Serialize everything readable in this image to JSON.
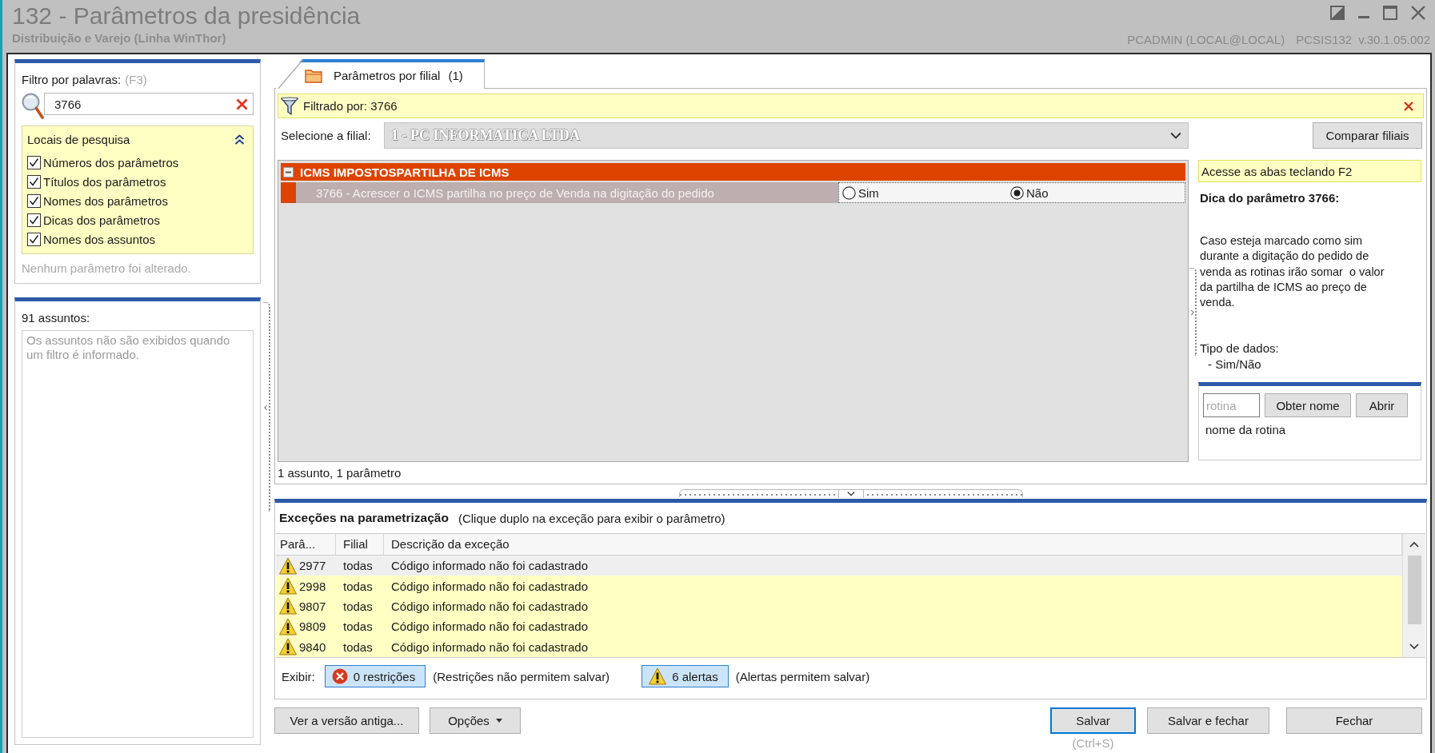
{
  "window": {
    "title": "132 - Parâmetros da presidência",
    "subtitle": "Distribuição e Varejo (Linha WinThor)",
    "user": "PCADMIN (LOCAL@LOCAL)",
    "routine": "PCSIS132",
    "version": "v.30.1.05.002"
  },
  "filter_panel": {
    "label": "Filtro por palavras:",
    "shortcut": "(F3)",
    "search": {
      "value": "3766"
    },
    "search_places": {
      "title": "Locais de pesquisa",
      "expanded": true,
      "items": [
        {
          "label": "Números dos parâmetros",
          "checked": true
        },
        {
          "label": "Títulos dos parâmetros",
          "checked": true
        },
        {
          "label": "Nomes dos parâmetros",
          "checked": true
        },
        {
          "label": "Dicas dos parâmetros",
          "checked": true
        },
        {
          "label": "Nomes dos assuntos",
          "checked": true
        }
      ]
    },
    "status": "Nenhum parâmetro foi alterado."
  },
  "subjects_panel": {
    "title": "91 assuntos:",
    "message": "Os assuntos não são exibidos quando um filtro é informado."
  },
  "tabs": [
    {
      "label": "Parâmetros por filial",
      "count": "(1)",
      "selected": true
    }
  ],
  "filter_bar": {
    "text": "Filtrado por: 3766"
  },
  "branch": {
    "label": "Selecione a filial:",
    "value": "1 - PC INFORMATICA LTDA",
    "disabled": true
  },
  "compare_button": "Comparar filiais",
  "parameters": {
    "groups": [
      {
        "title": "ICMS IMPOSTOSPARTILHA DE ICMS",
        "expanded": true,
        "children": [
          {
            "label": "3766 - Acrescer o ICMS partilha no preço de Venda na digitação do pedido",
            "options": [
              {
                "label": "Sim",
                "selected": false
              },
              {
                "label": "Não",
                "selected": true
              }
            ]
          }
        ]
      }
    ],
    "summary": "1 assunto, 1 parâmetro"
  },
  "hint_panel": {
    "notice": "Acesse as abas teclando F2",
    "title": "Dica do parâmetro 3766:",
    "text": "Caso esteja marcado como sim\ndurante a digitação do pedido de\nvenda as rotinas irão somar  o valor\nda partilha de ICMS ao preço de\nvenda.",
    "data_type_label": "Tipo de dados:",
    "data_type": "- Sim/Não"
  },
  "routine_lookup": {
    "input": {
      "placeholder": "rotina"
    },
    "buttons": [
      "Obter nome",
      "Abrir"
    ],
    "result": "nome da rotina"
  },
  "exceptions": {
    "title": "Exceções na parametrização",
    "hint": "(Clique duplo na exceção para exibir o parâmetro)",
    "columns": [
      "Parâ...",
      "Filial",
      "Descrição da exceção"
    ],
    "rows": [
      {
        "kind": "alert",
        "selected": true,
        "cells": [
          "2977",
          "todas",
          "Código informado não foi cadastrado"
        ]
      },
      {
        "kind": "alert",
        "selected": false,
        "cells": [
          "2998",
          "todas",
          "Código informado não foi cadastrado"
        ]
      },
      {
        "kind": "alert",
        "selected": false,
        "cells": [
          "9807",
          "todas",
          "Código informado não foi cadastrado"
        ]
      },
      {
        "kind": "alert",
        "selected": false,
        "cells": [
          "9809",
          "todas",
          "Código informado não foi cadastrado"
        ]
      },
      {
        "kind": "alert",
        "selected": false,
        "cells": [
          "9840",
          "todas",
          "Código informado não foi cadastrado"
        ]
      }
    ],
    "filter_label": "Exibir:",
    "toggles": [
      {
        "kind": "restriction",
        "label": "0 restrições",
        "note": "(Restrições não permitem salvar)",
        "on": true
      },
      {
        "kind": "alert",
        "label": "6 alertas",
        "note": "(Alertas permitem salvar)",
        "on": true
      }
    ]
  },
  "footer": {
    "left_buttons": [
      {
        "kind": "plain",
        "label": "Ver a versão antiga..."
      },
      {
        "kind": "menu",
        "label": "Opções"
      }
    ],
    "right_buttons": [
      {
        "label": "Salvar",
        "focused": true,
        "shortcut": "(Ctrl+S)"
      },
      {
        "label": "Salvar e fechar",
        "focused": false
      },
      {
        "label": "Fechar",
        "focused": false
      }
    ]
  }
}
